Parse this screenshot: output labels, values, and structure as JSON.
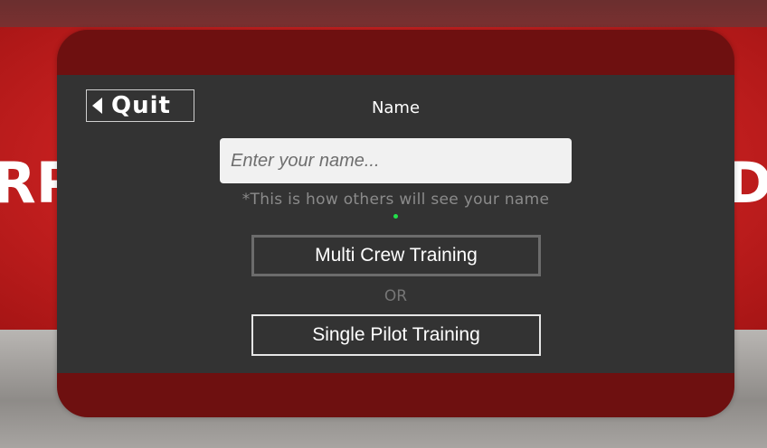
{
  "background": {
    "left_text": "RP",
    "right_text": "D",
    "wall_color": "#cf2323"
  },
  "panel": {
    "quit_label": "Quit",
    "quit_icon": "back-arrow-icon",
    "name_title": "Name",
    "name_input": {
      "placeholder": "Enter your name...",
      "value": ""
    },
    "hint": "*This is how others will see your name",
    "multi_crew_label": "Multi Crew Training",
    "or_label": "OR",
    "single_pilot_label": "Single Pilot Training",
    "colors": {
      "frame": "#6e1010",
      "body": "#333333",
      "status_dot": "#22e04a"
    }
  }
}
